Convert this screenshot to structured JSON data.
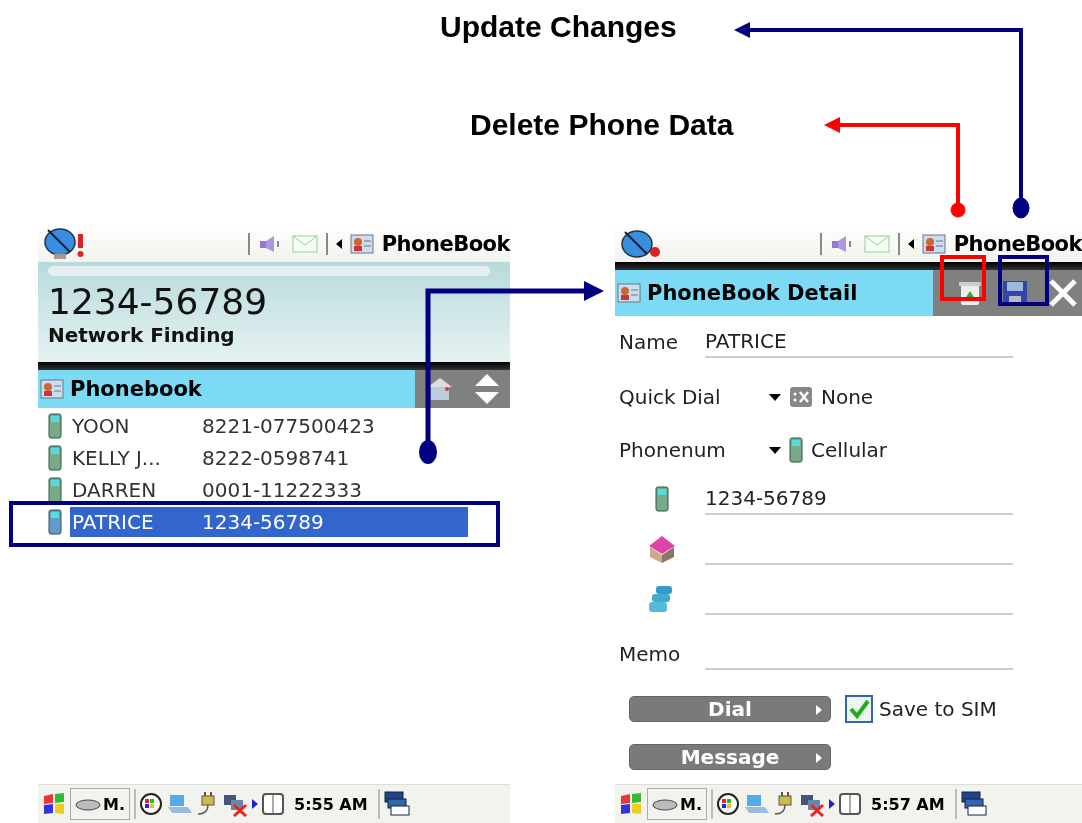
{
  "annotations": [
    {
      "text": "Update Changes",
      "color": "#000080"
    },
    {
      "text": "Delete Phone Data",
      "color": "#ff0000"
    }
  ],
  "list_screen": {
    "status_title": "PhoneBook",
    "number": "1234-56789",
    "network": "Network Finding",
    "title": "Phonebook",
    "contacts": [
      {
        "name": "YOON",
        "number": "8221-077500423",
        "selected": false
      },
      {
        "name": "KELLY J...",
        "number": "8222-0598741",
        "selected": false
      },
      {
        "name": "DARREN",
        "number": "0001-11222333",
        "selected": false
      },
      {
        "name": "PATRICE",
        "number": "1234-56789",
        "selected": true
      }
    ],
    "taskbar": {
      "app": "M.",
      "time": "5:55 AM"
    }
  },
  "detail_screen": {
    "status_title": "PhoneBook",
    "title": "PhoneBook Detail",
    "name_label": "Name",
    "name_value": "PATRICE",
    "quick_dial_label": "Quick Dial",
    "quick_dial_value": "None",
    "phonenum_label": "Phonenum",
    "phonenum_type": "Cellular",
    "numbers": [
      {
        "kind": "mobile",
        "value": "1234-56789"
      },
      {
        "kind": "home"
      },
      {
        "kind": "office"
      }
    ],
    "memo_label": "Memo",
    "buttons": [
      "Dial",
      "Message"
    ],
    "save_to_sim": {
      "label": "Save to SIM",
      "checked": true
    },
    "taskbar": {
      "app": "M.",
      "time": "5:57 AM"
    }
  }
}
